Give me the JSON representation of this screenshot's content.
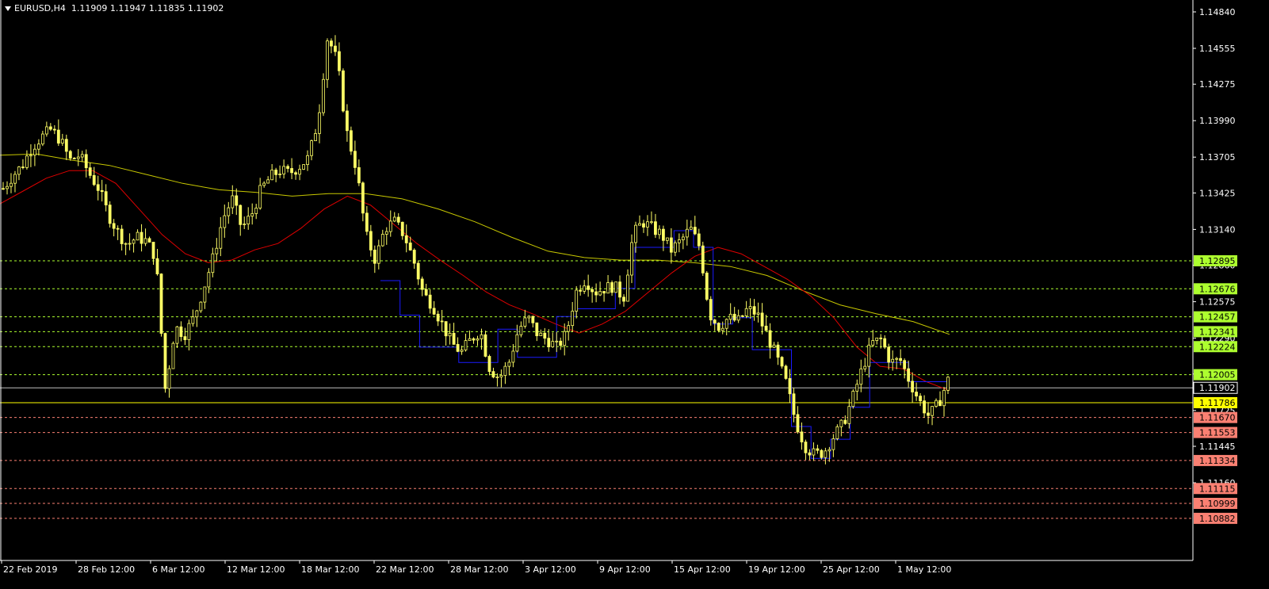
{
  "header": {
    "symbol": "EURUSD,H4",
    "ohlc": "1.11909 1.11947 1.11835 1.11902"
  },
  "colors": {
    "background": "#000000",
    "candle": "#ffff66",
    "ma_fast": "#e00000",
    "ma_slow": "#c8c800",
    "stepline": "#1a1aff",
    "resistance": "#adff2f",
    "support": "#fa8072",
    "current_price": "#c0c0c0",
    "key_level": "#ffff00"
  },
  "chart_data": {
    "type": "candlestick",
    "symbol": "EURUSD",
    "timeframe": "H4",
    "ylim": [
      1.1078,
      1.1493
    ],
    "y_ticks": [
      "1.14840",
      "1.14555",
      "1.14275",
      "1.13990",
      "1.13705",
      "1.13425",
      "1.13140",
      "1.12860",
      "1.12575",
      "1.12290",
      "1.12010",
      "1.11725",
      "1.11445",
      "1.11160"
    ],
    "x_ticks": [
      "22 Feb 2019",
      "28 Feb 12:00",
      "6 Mar 12:00",
      "12 Mar 12:00",
      "18 Mar 12:00",
      "22 Mar 12:00",
      "28 Mar 12:00",
      "3 Apr 12:00",
      "9 Apr 12:00",
      "15 Apr 12:00",
      "19 Apr 12:00",
      "25 Apr 12:00",
      "1 May 12:00"
    ],
    "levels": [
      {
        "price": 1.12895,
        "label": "1.12895",
        "kind": "resistance"
      },
      {
        "price": 1.12676,
        "label": "1.12676",
        "kind": "resistance"
      },
      {
        "price": 1.12457,
        "label": "1.12457",
        "kind": "resistance"
      },
      {
        "price": 1.12341,
        "label": "1.12341",
        "kind": "resistance"
      },
      {
        "price": 1.12224,
        "label": "1.12224",
        "kind": "resistance"
      },
      {
        "price": 1.12005,
        "label": "1.12005",
        "kind": "resistance"
      },
      {
        "price": 1.11902,
        "label": "1.11902",
        "kind": "current"
      },
      {
        "price": 1.11786,
        "label": "1.11786",
        "kind": "key"
      },
      {
        "price": 1.1167,
        "label": "1.11670",
        "kind": "support"
      },
      {
        "price": 1.11553,
        "label": "1.11553",
        "kind": "support"
      },
      {
        "price": 1.11334,
        "label": "1.11334",
        "kind": "support"
      },
      {
        "price": 1.11115,
        "label": "1.11115",
        "kind": "support"
      },
      {
        "price": 1.10999,
        "label": "1.10999",
        "kind": "support"
      },
      {
        "price": 1.10882,
        "label": "1.10882",
        "kind": "support"
      }
    ],
    "close_path": [
      1.1346,
      1.1356,
      1.1364,
      1.1378,
      1.1386,
      1.1392,
      1.1384,
      1.1368,
      1.1372,
      1.1358,
      1.1346,
      1.1326,
      1.1312,
      1.1302,
      1.1308,
      1.1305,
      1.1292,
      1.1188,
      1.1238,
      1.1232,
      1.1245,
      1.1268,
      1.1292,
      1.1322,
      1.1338,
      1.1315,
      1.1325,
      1.1345,
      1.1355,
      1.136,
      1.1358,
      1.1363,
      1.137,
      1.14,
      1.1465,
      1.1445,
      1.139,
      1.1362,
      1.131,
      1.129,
      1.1315,
      1.132,
      1.131,
      1.129,
      1.1264,
      1.1255,
      1.124,
      1.1225,
      1.1218,
      1.1228,
      1.1235,
      1.1205,
      1.1198,
      1.121,
      1.1236,
      1.1245,
      1.1232,
      1.1228,
      1.1222,
      1.1232,
      1.1265,
      1.1275,
      1.1265,
      1.1268,
      1.127,
      1.126,
      1.131,
      1.132,
      1.1315,
      1.131,
      1.1298,
      1.1305,
      1.1315,
      1.13,
      1.1248,
      1.1238,
      1.1245,
      1.1242,
      1.1252,
      1.1248,
      1.1232,
      1.1215,
      1.1195,
      1.1165,
      1.1145,
      1.1138,
      1.114,
      1.1152,
      1.1162,
      1.1182,
      1.1205,
      1.1225,
      1.1228,
      1.121,
      1.1212,
      1.1195,
      1.118,
      1.1168,
      1.1178,
      1.1196
    ],
    "ma_fast_path": [
      1.1334,
      1.1344,
      1.1354,
      1.136,
      1.136,
      1.135,
      1.133,
      1.131,
      1.1295,
      1.1288,
      1.129,
      1.1298,
      1.1303,
      1.1315,
      1.133,
      1.134,
      1.1333,
      1.1318,
      1.1303,
      1.129,
      1.1278,
      1.1265,
      1.1255,
      1.1248,
      1.124,
      1.1233,
      1.124,
      1.125,
      1.1265,
      1.128,
      1.1293,
      1.13,
      1.1295,
      1.1285,
      1.1275,
      1.1262,
      1.1245,
      1.1222,
      1.1207,
      1.1205,
      1.1195,
      1.1188
    ],
    "ma_slow_path": [
      1.1372,
      1.1373,
      1.1368,
      1.1364,
      1.1357,
      1.135,
      1.1345,
      1.1343,
      1.134,
      1.1342,
      1.1342,
      1.1338,
      1.133,
      1.132,
      1.1308,
      1.1297,
      1.1292,
      1.129,
      1.129,
      1.1288,
      1.1285,
      1.1278,
      1.1266,
      1.1255,
      1.1248,
      1.1242,
      1.1232
    ],
    "step_path": [
      1.1274,
      1.1247,
      1.1222,
      1.1222,
      1.121,
      1.121,
      1.1236,
      1.1214,
      1.1214,
      1.1246,
      1.1252,
      1.1252,
      1.1268,
      1.13,
      1.13,
      1.1313,
      1.13,
      1.124,
      1.1245,
      1.122,
      1.122,
      1.116,
      1.1135,
      1.115,
      1.1175,
      1.121,
      1.121,
      1.1195,
      1.1195,
      1.1188
    ]
  }
}
